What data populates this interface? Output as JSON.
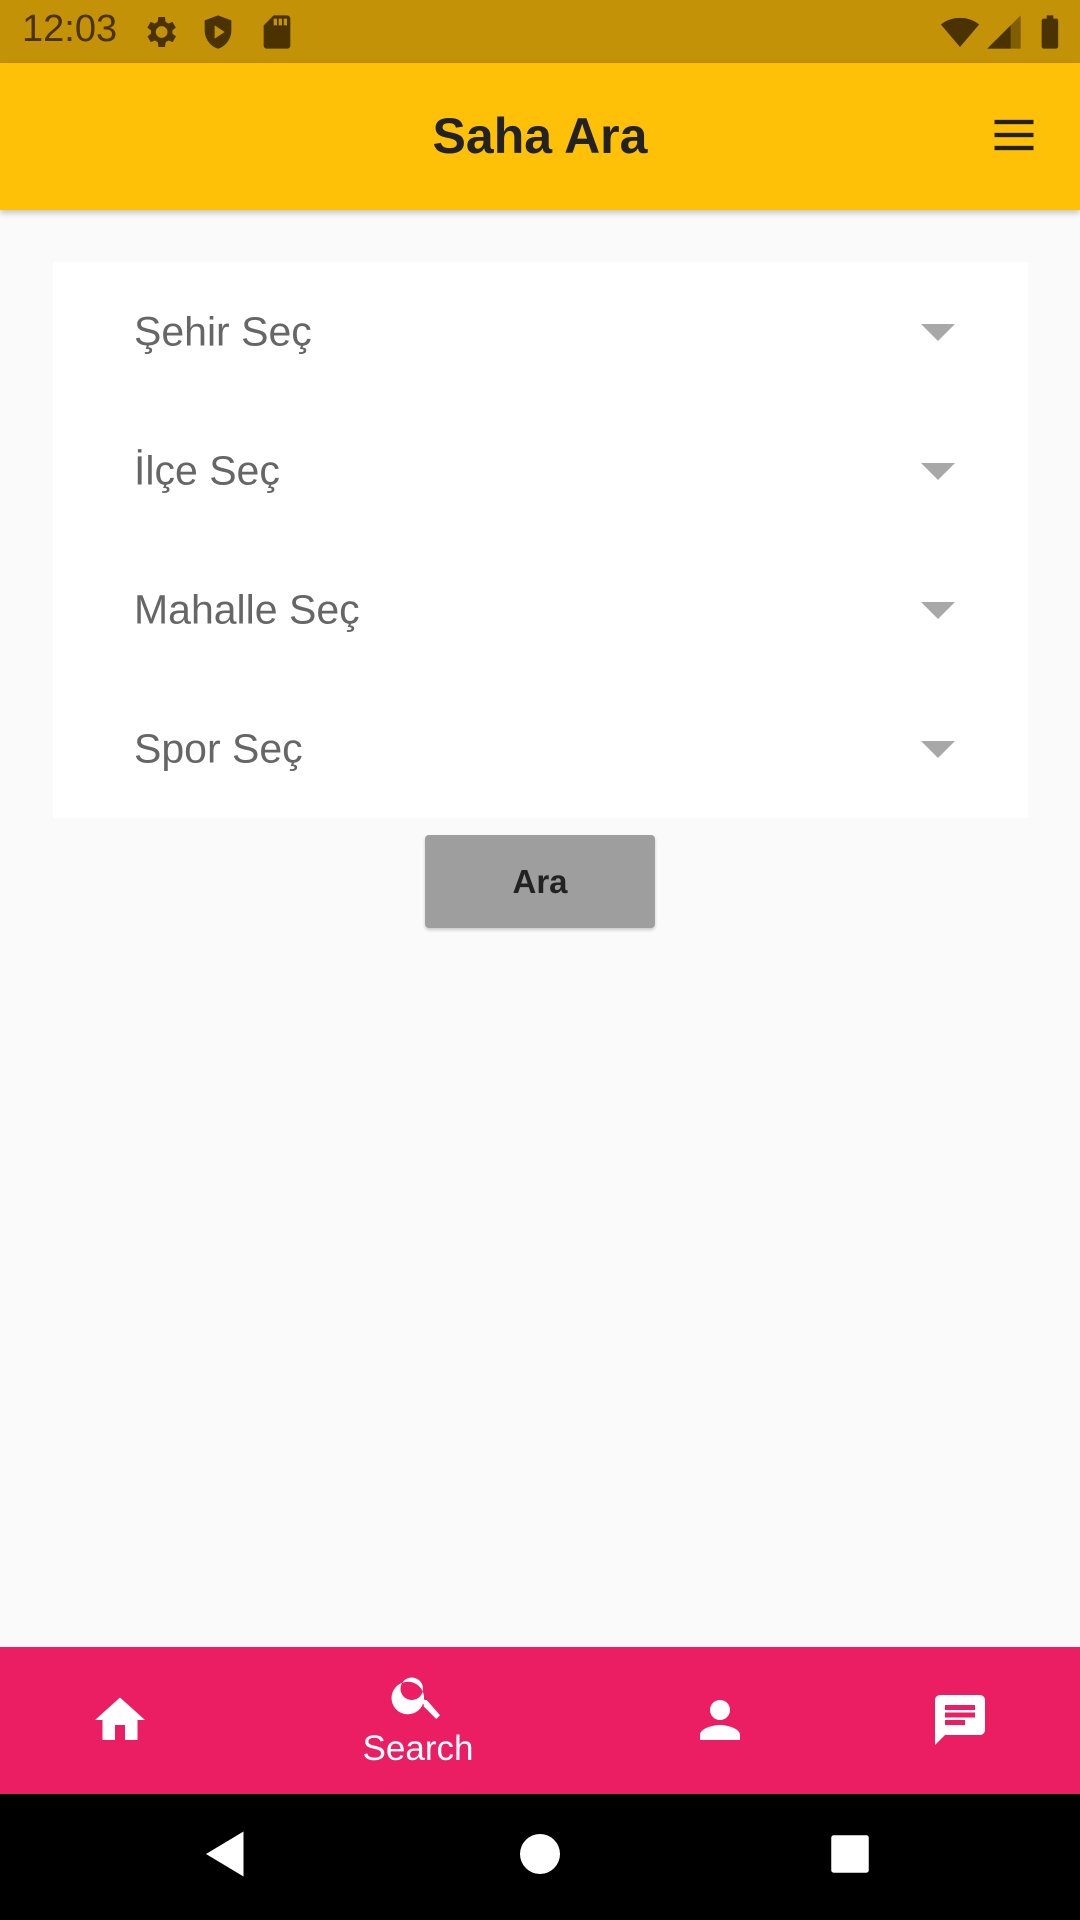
{
  "status_bar": {
    "time": "12:03",
    "left_icons": [
      "settings-icon",
      "shield-play-icon",
      "sd-card-icon"
    ],
    "right_icons": [
      "wifi-icon",
      "cell-signal-icon",
      "battery-icon"
    ]
  },
  "app_bar": {
    "title": "Saha Ara",
    "menu_icon": "hamburger-menu-icon"
  },
  "form": {
    "dropdowns": [
      {
        "label": "Şehir Seç"
      },
      {
        "label": "İlçe Seç"
      },
      {
        "label": "Mahalle Seç"
      },
      {
        "label": "Spor Seç"
      }
    ],
    "search_button_label": "Ara"
  },
  "bottom_nav": {
    "items": [
      {
        "icon": "home-icon",
        "label": ""
      },
      {
        "icon": "search-icon",
        "label": "Search",
        "active": true
      },
      {
        "icon": "person-icon",
        "label": ""
      },
      {
        "icon": "chat-icon",
        "label": ""
      }
    ]
  },
  "colors": {
    "status_bar": "#c39207",
    "app_bar": "#ffc108",
    "bottom_nav": "#eb1e63",
    "button": "#9e9e9e",
    "background": "#fafafa"
  }
}
